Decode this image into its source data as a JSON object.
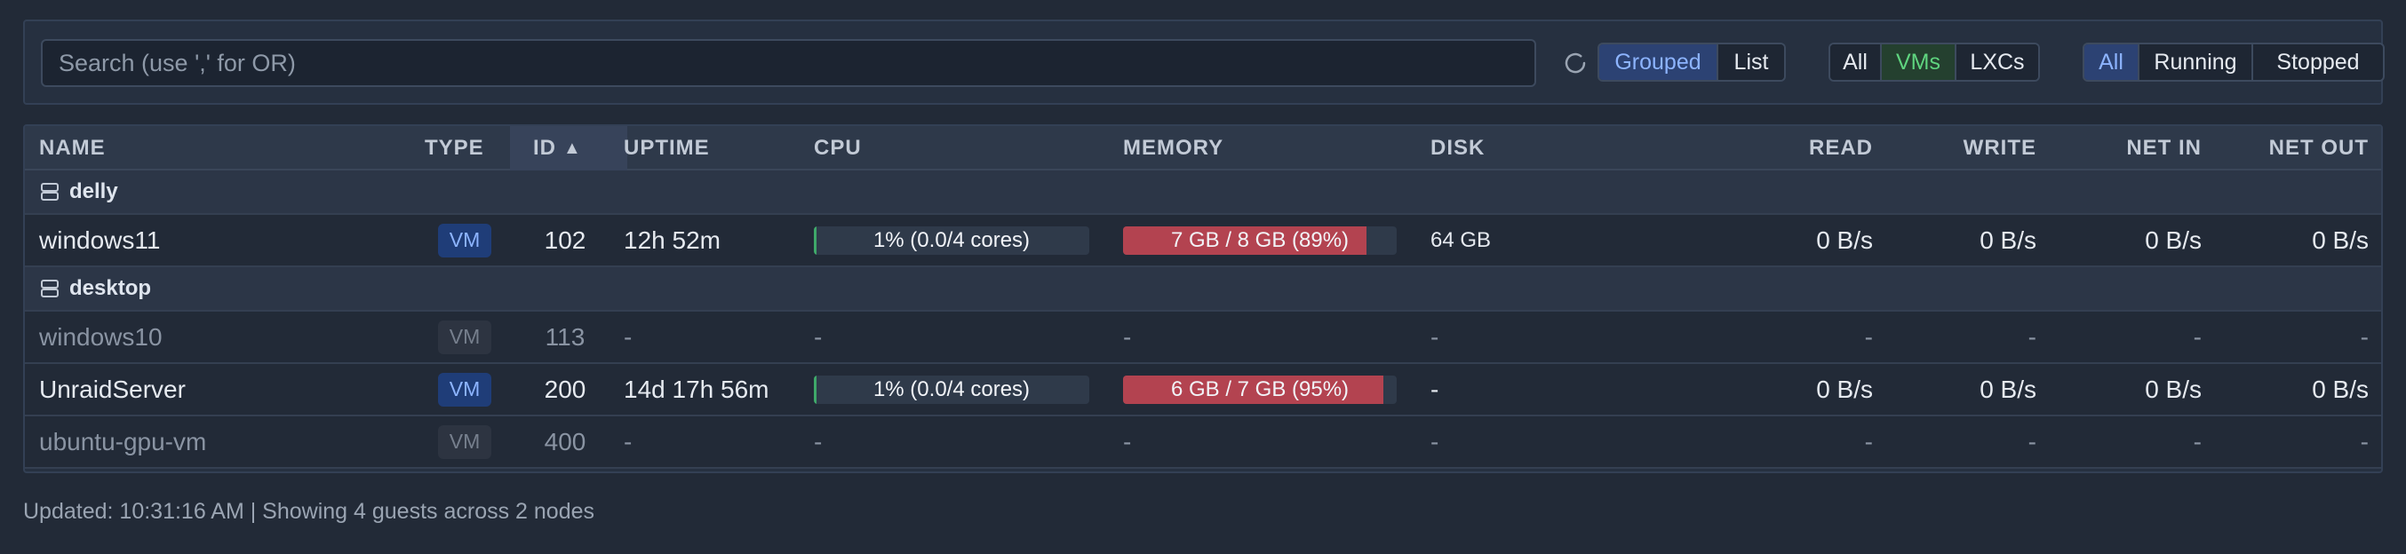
{
  "toolbar": {
    "search_placeholder": "Search (use ',' for OR)",
    "search_value": "",
    "view_options": [
      "Grouped",
      "List"
    ],
    "view_selected": "Grouped",
    "type_options": [
      "All",
      "VMs",
      "LXCs"
    ],
    "type_selected": "VMs",
    "status_options": [
      "All",
      "Running",
      "Stopped"
    ],
    "status_selected": "All"
  },
  "columns": {
    "name": "NAME",
    "type": "TYPE",
    "id": "ID",
    "id_sort_indicator": "▲",
    "uptime": "UPTIME",
    "cpu": "CPU",
    "memory": "MEMORY",
    "disk": "DISK",
    "read": "READ",
    "write": "WRITE",
    "net_in": "NET IN",
    "net_out": "NET OUT"
  },
  "groups": [
    {
      "node": "delly",
      "guests": [
        {
          "name": "windows11",
          "type": "VM",
          "id": "102",
          "uptime": "12h 52m",
          "running": true,
          "cpu_label": "1% (0.0/4 cores)",
          "cpu_pct": 1,
          "memory_label": "7 GB / 8 GB (89%)",
          "memory_pct": 89,
          "disk": "64 GB",
          "read": "0 B/s",
          "write": "0 B/s",
          "net_in": "0 B/s",
          "net_out": "0 B/s"
        }
      ]
    },
    {
      "node": "desktop",
      "guests": [
        {
          "name": "windows10",
          "type": "VM",
          "id": "113",
          "uptime": "-",
          "running": false,
          "cpu_label": "-",
          "memory_label": "-",
          "disk": "-",
          "read": "-",
          "write": "-",
          "net_in": "-",
          "net_out": "-"
        },
        {
          "name": "UnraidServer",
          "type": "VM",
          "id": "200",
          "uptime": "14d 17h 56m",
          "running": true,
          "cpu_label": "1% (0.0/4 cores)",
          "cpu_pct": 1,
          "memory_label": "6 GB / 7 GB (95%)",
          "memory_pct": 95,
          "disk": "-",
          "read": "0 B/s",
          "write": "0 B/s",
          "net_in": "0 B/s",
          "net_out": "0 B/s"
        },
        {
          "name": "ubuntu-gpu-vm",
          "type": "VM",
          "id": "400",
          "uptime": "-",
          "running": false,
          "cpu_label": "-",
          "memory_label": "-",
          "disk": "-",
          "read": "-",
          "write": "-",
          "net_in": "-",
          "net_out": "-"
        }
      ]
    }
  ],
  "footer": {
    "text": "Updated: 10:31:16 AM | Showing 4 guests across 2 nodes"
  },
  "colors": {
    "accent_blue": "#8db4ff",
    "vm_green": "#5fd47f",
    "memory_high": "#b34350",
    "cpu_low": "#3fa96a"
  }
}
